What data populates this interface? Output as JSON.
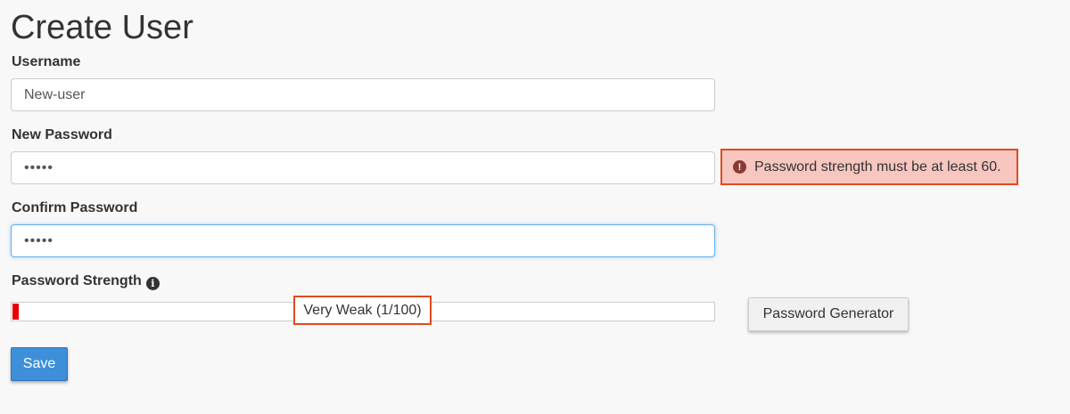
{
  "page": {
    "title": "Create User"
  },
  "form": {
    "username": {
      "label": "Username",
      "value": "New-user"
    },
    "new_password": {
      "label": "New Password",
      "value": "•••••"
    },
    "confirm_password": {
      "label": "Confirm Password",
      "value": "•••••"
    },
    "error": {
      "message": "Password strength must be at least 60.",
      "icon": "exclamation-circle-icon",
      "color": "#e04a1f"
    },
    "strength": {
      "label": "Password Strength",
      "info_icon": "info-circle-icon",
      "text": "Very Weak (1/100)",
      "score": 1,
      "max": 100,
      "bar_color": "#e80000"
    },
    "generator_label": "Password Generator",
    "save_label": "Save",
    "accent_color": "#3d8fd9"
  }
}
